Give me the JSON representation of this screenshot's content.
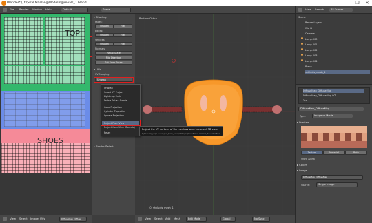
{
  "window": {
    "title": "Blender* [D:\\Siral Maslang\\Modeling\\meals_1.blend]",
    "controls": [
      "–",
      "❐",
      "✕"
    ]
  },
  "menubar": {
    "items": [
      "File",
      "Render",
      "Window",
      "Help"
    ],
    "layout": "Default",
    "scene": "Scene",
    "engine": "Blender Render",
    "stats": "v2.76 | Verts:1/1,500 | Faces:756/1,665 | Tris:10,520 | Objects:1/8 | Lamps:0/1"
  },
  "uv_editor": {
    "labels": {
      "top": "TOP",
      "shoes": "SHOES"
    },
    "footer": [
      "View",
      "Select",
      "Image",
      "UVs"
    ],
    "image_name": "DiffuseMap_Diffuse",
    "colors": {
      "green": "#33b86c",
      "blue": "#6b8ce8",
      "pink": "#f58a98",
      "pink_light": "#f9b0b8"
    }
  },
  "tool_panel": {
    "shading_header": "▾ Shading",
    "faces": "Faces:",
    "smooth": "Smooth",
    "flat": "Flat",
    "edges": "Edges:",
    "vertices": "Vertices:",
    "normals": "Normals:",
    "recalculate": "Recalculate",
    "flip_direction": "Flip Direction",
    "set_from_faces": "Set From Faces",
    "uvs_header": "▾ UVs",
    "unwrap_label": "UV Mapping",
    "unwrap": "Unwrap",
    "border_select": "▸ Border Select"
  },
  "unwrap_menu": {
    "items": [
      "Unwrap",
      "Smart UV Project",
      "Lightmap Pack",
      "Follow Active Quads",
      "Cube Projection",
      "Cylinder Projection",
      "Sphere Projection",
      "Project From View",
      "Project from View (Bounds)",
      "Reset"
    ],
    "highlighted": "Project From View"
  },
  "tooltip": {
    "title": "Project the UV vertices of the mesh as seen in current 3D view",
    "python": "Python: bpy.ops.uv.project_from_view(orthographic=False, camera_bounds=True, ...)"
  },
  "viewport": {
    "view_name": "Bottom Ortho",
    "object_name": "(0) shkludis_mesh_1",
    "footer": [
      "View",
      "Select",
      "Add",
      "Mesh"
    ],
    "mode": "Edit Mode",
    "pivot": "Global",
    "shading": "No Sync"
  },
  "outliner": {
    "header": [
      "View",
      "Search",
      "All Scenes"
    ],
    "rows": [
      "Scene",
      "RenderLayers",
      "World",
      "Camera",
      "Lamp.000",
      "Lamp.001",
      "Lamp.002",
      "Lamp.003",
      "Lamp.004",
      "Plane",
      "shkludis_mesh_1"
    ]
  },
  "properties": {
    "textures": [
      "DiffuseMap_DiffuseMap",
      "DiffuseMap_DiffuseMap.001",
      "Tex"
    ],
    "tex_name": "DiffuseMap_DiffuseMap",
    "type_label": "Type:",
    "type_value": "Image or Movie",
    "preview_label": "▾ Preview",
    "preview_tabs": [
      "Texture",
      "Material",
      "Both"
    ],
    "colors_label": "▸ Colors",
    "image_label": "▾ Image",
    "source_label": "Source:",
    "source_value": "Single Image",
    "show_alpha": "Show Alpha"
  }
}
